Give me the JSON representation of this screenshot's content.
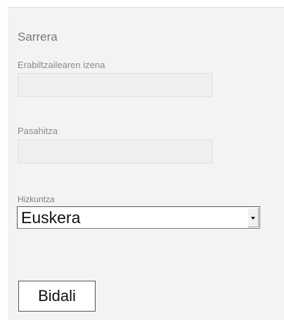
{
  "form": {
    "title": "Sarrera",
    "username": {
      "label": "Erabiltzailearen izena",
      "value": "",
      "placeholder": ""
    },
    "password": {
      "label": "Pasahitza",
      "value": "",
      "placeholder": ""
    },
    "language": {
      "label": "Hizkuntza",
      "selected": "Euskera"
    },
    "submit_label": "Bidali"
  }
}
